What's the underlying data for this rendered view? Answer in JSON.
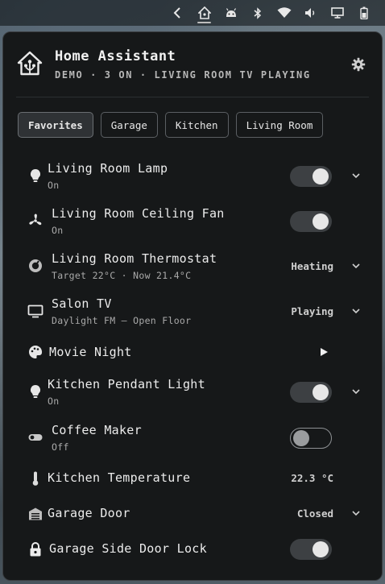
{
  "tray": {
    "icons": [
      "back-arrow-icon",
      "home-assistant-icon",
      "android-icon",
      "bluetooth-icon",
      "wifi-icon",
      "volume-icon",
      "monitor-icon",
      "battery-icon"
    ]
  },
  "header": {
    "title": "Home Assistant",
    "subtitle": "DEMO · 3 ON · LIVING ROOM TV PLAYING"
  },
  "tabs": [
    {
      "label": "Favorites",
      "selected": true
    },
    {
      "label": "Garage",
      "selected": false
    },
    {
      "label": "Kitchen",
      "selected": false
    },
    {
      "label": "Living Room",
      "selected": false
    }
  ],
  "entities": [
    {
      "name": "Living Room Lamp",
      "sub": "On",
      "control": "toggle",
      "on": true,
      "expand": true,
      "icon": "lightbulb-icon"
    },
    {
      "name": "Living Room Ceiling Fan",
      "sub": "On",
      "control": "toggle",
      "on": true,
      "expand": false,
      "icon": "fan-icon"
    },
    {
      "name": "Living Room Thermostat",
      "sub": "Target 22°C · Now 21.4°C",
      "control": "state",
      "state": "Heating",
      "expand": true,
      "icon": "thermostat-icon"
    },
    {
      "name": "Salon TV",
      "sub": "Daylight FM — Open Floor",
      "control": "state",
      "state": "Playing",
      "expand": true,
      "icon": "tv-icon"
    },
    {
      "name": "Movie Night",
      "sub": "",
      "control": "play",
      "expand": false,
      "icon": "palette-icon"
    },
    {
      "name": "Kitchen Pendant Light",
      "sub": "On",
      "control": "toggle",
      "on": true,
      "expand": true,
      "icon": "lightbulb-icon"
    },
    {
      "name": "Coffee Maker",
      "sub": "Off",
      "control": "toggle",
      "on": false,
      "expand": false,
      "icon": "switch-icon"
    },
    {
      "name": "Kitchen Temperature",
      "sub": "",
      "control": "state",
      "state": "22.3 °C",
      "expand": false,
      "icon": "thermometer-icon"
    },
    {
      "name": "Garage Door",
      "sub": "",
      "control": "state",
      "state": "Closed",
      "expand": true,
      "icon": "garage-icon"
    },
    {
      "name": "Garage Side Door Lock",
      "sub": "",
      "control": "toggle",
      "on": true,
      "expand": false,
      "icon": "lock-icon"
    }
  ]
}
